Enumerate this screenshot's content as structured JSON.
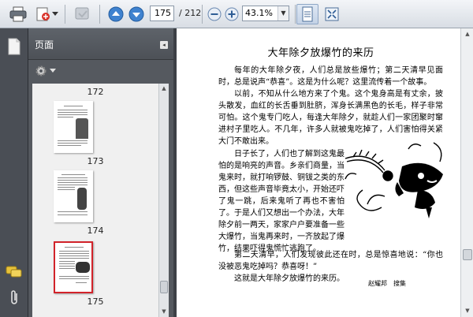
{
  "toolbar": {
    "page_current": "175",
    "page_total": "/ 212",
    "zoom_value": "43.1%",
    "icons": [
      "print-icon",
      "export-icon",
      "review-icon",
      "previous-page-icon",
      "next-page-icon",
      "zoom-out-icon",
      "zoom-in-icon",
      "scrolling-mode-icon",
      "full-screen-icon"
    ]
  },
  "sidebar": {
    "panel_title": "页面",
    "thumbnails": [
      {
        "label": "172"
      },
      {
        "label": "173"
      },
      {
        "label": "174"
      },
      {
        "label": "175"
      }
    ]
  },
  "document": {
    "title": "大年除夕放爆竹的来历",
    "paragraphs": [
      "每年的大年除夕夜，人们总是放些爆竹；第二天清早见面时，总是说声“恭喜”。这是为什么呢？这里流传着一个故事。",
      "以前，不知从什么地方来了个鬼。这个鬼身高是有丈余，披头散发，血红的长舌垂到肚脐，浑身长满黑色的长毛，样子非常可怕。这个鬼专门吃人，每逢大年除夕，就趁人们一家团聚时窜进村子里吃人。不几年，许多人就被鬼吃掉了，人们害怕得关紧大门不敢出来。",
      "日子长了，人们也了解到这鬼最怕的是响亮的声音。乡亲们商量，当鬼来时，就打响锣鼓、铜钹之类的东西，但这些声音毕竟太小，开始还吓了鬼一跳，后来鬼听了再也不害怕了。于是人们又想出一个办法，大年除夕前一两天，家家户户要准备一些大爆竹，当鬼再来时，一齐放起了爆竹，结果吓得鬼慌忙逃跑了。",
      "第二天清早，人们发现彼此还在时，总是惊喜地说：“你也没被恶鬼吃掉吗？恭喜呀！”",
      "这就是大年除夕放爆竹的来历。"
    ],
    "credit": "赵耀邦　搜集"
  },
  "colors": {
    "panel_bg": "#55595f",
    "rail_bg": "#4a4e55",
    "current_thumb_border": "#d2232a"
  }
}
